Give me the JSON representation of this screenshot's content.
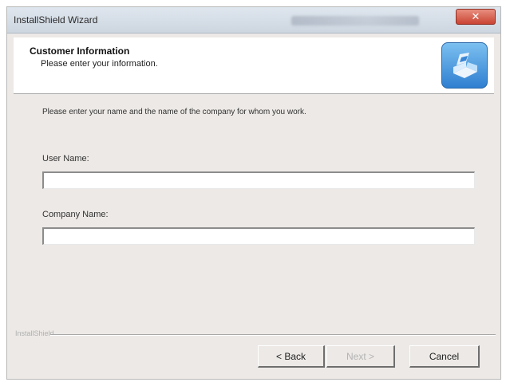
{
  "window": {
    "title": "InstallShield Wizard",
    "close_glyph": "✕"
  },
  "header": {
    "title": "Customer Information",
    "subtitle": "Please enter your information."
  },
  "body": {
    "instructions": "Please enter your name and the name of the company for whom you work.",
    "user_name": {
      "label": "User Name:",
      "value": ""
    },
    "company_name": {
      "label": "Company Name:",
      "value": ""
    }
  },
  "footer": {
    "brand_label": "InstallShield",
    "back_label": "< Back",
    "next_label": "Next >",
    "cancel_label": "Cancel"
  },
  "icons": {
    "logo": "installshield-logo-icon",
    "close": "close-icon"
  }
}
